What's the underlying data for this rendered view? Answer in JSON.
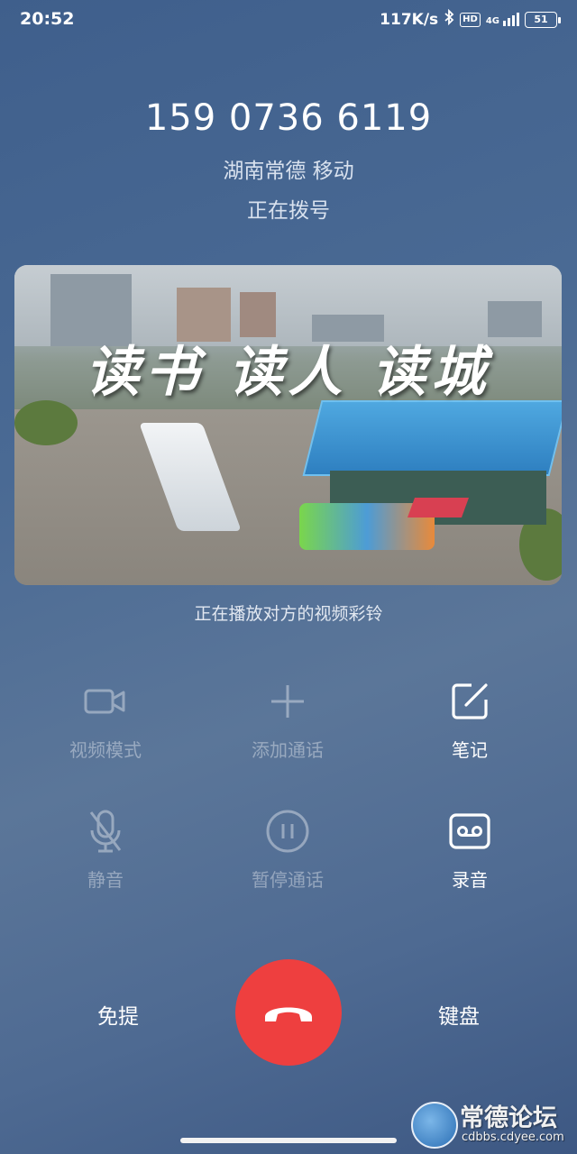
{
  "status_bar": {
    "time": "20:52",
    "net_speed": "117K/s",
    "hd": "HD",
    "network": "4G",
    "battery": "51"
  },
  "call": {
    "number": "159 0736 6119",
    "location": "湖南常德 移动",
    "state": "正在拨号"
  },
  "video_ringtone": {
    "overlay_text": "读书 读人 读城",
    "caption": "正在播放对方的视频彩铃"
  },
  "actions": {
    "video_mode": "视频模式",
    "add_call": "添加通话",
    "notes": "笔记",
    "mute": "静音",
    "hold": "暂停通话",
    "record": "录音"
  },
  "bottom": {
    "speaker": "免提",
    "keypad": "键盘"
  },
  "watermark": {
    "title": "常德论坛",
    "url": "cdbbs.cdyee.com"
  },
  "colors": {
    "hangup": "#ee3f3f",
    "background": "#4a6a94"
  }
}
